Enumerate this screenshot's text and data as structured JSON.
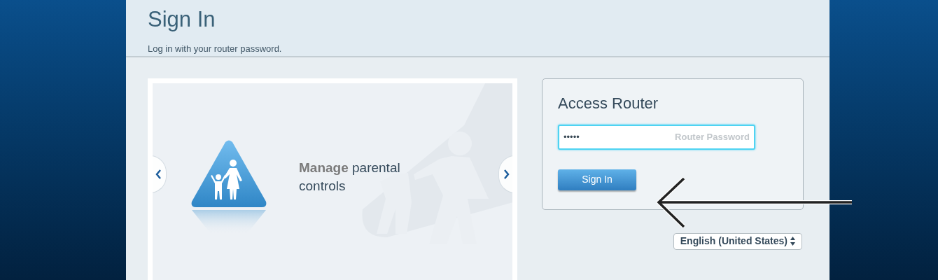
{
  "header": {
    "title": "Sign In",
    "subtitle": "Log in with your router password."
  },
  "carousel": {
    "caption": "**Manage** parental controls"
  },
  "login": {
    "title": "Access Router",
    "password": {
      "value": "•••••",
      "label": "Router Password",
      "focused": true
    },
    "button": "Sign In"
  },
  "language": {
    "value": "English (United States)"
  }
}
